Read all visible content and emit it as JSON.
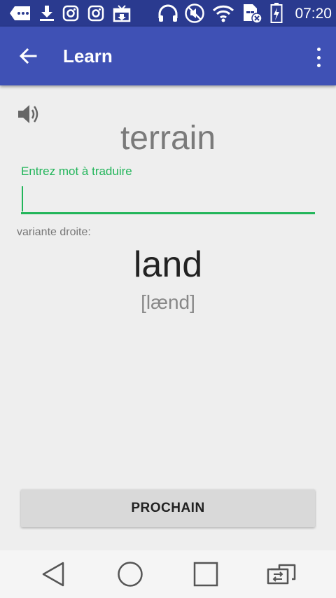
{
  "status_bar": {
    "time": "07:20",
    "icons": [
      "chat-icon",
      "download-icon",
      "instagram-icon",
      "instagram-icon",
      "gift-download-icon",
      "headphones-icon",
      "mute-icon",
      "wifi-icon",
      "sim-no-signal-icon",
      "battery-charging-icon"
    ]
  },
  "app_bar": {
    "title": "Learn"
  },
  "card": {
    "word": "terrain",
    "input_hint": "Entrez mot à traduire",
    "input_value": "",
    "variant_label": "variante droite:",
    "answer": "land",
    "transcription": "[lænd]"
  },
  "footer": {
    "next_label": "PROCHAIN"
  },
  "nav_bar": {
    "icons": [
      "back-triangle-icon",
      "home-circle-icon",
      "recents-square-icon",
      "screen-switch-icon"
    ]
  },
  "colors": {
    "status_bar": "#2a3a8f",
    "app_bar": "#3f51b5",
    "accent": "#22b55a"
  }
}
